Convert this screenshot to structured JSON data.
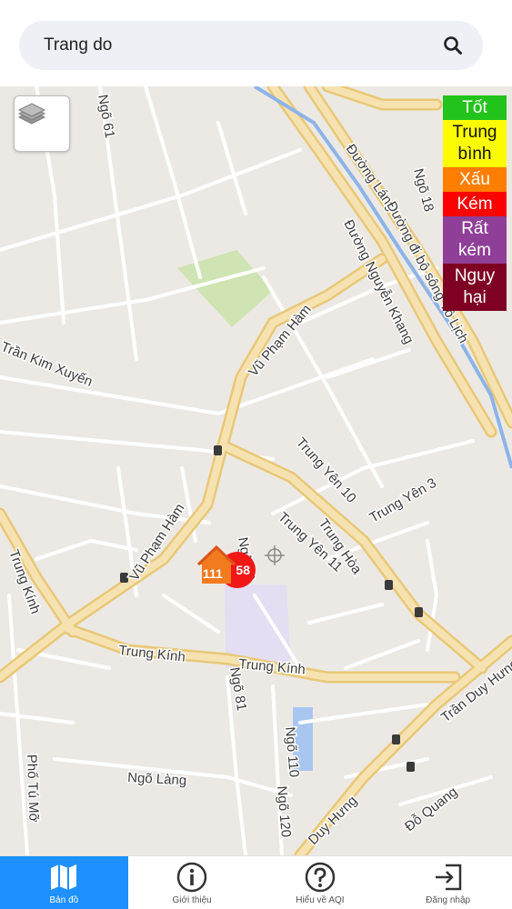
{
  "search": {
    "value": "Trang do",
    "icon": "search-icon"
  },
  "map": {
    "layer_button_icon": "layers-icon",
    "street_labels": [
      "Ngõ 61",
      "Đường Láng",
      "Ngõ 18",
      "Đường Nguyễn Khang",
      "Đường đi bộ sông Tô Lịch",
      "Vũ Phạm Hàm",
      "Trần Kim Xuyến",
      "Trung Yên 10",
      "Trung Yên 3",
      "Vũ Phạm Hàm",
      "Trung Yên 11",
      "Trung Hòa",
      "Trung Kính",
      "Trung Kính",
      "Trung Kính",
      "Ngõ 81",
      "Ngõ 89",
      "Ngõ 110",
      "Ngõ 120",
      "Ngõ Làng",
      "Phố Tú Mỡ",
      "Trần Duy Hưng",
      "Đỗ Quang",
      "Duy Hưng"
    ],
    "markers": {
      "house_value": "111",
      "circle_value": "58"
    }
  },
  "legend": [
    {
      "label": "Tốt",
      "color": "#22c31b",
      "text_color": "#ffffff"
    },
    {
      "label": "Trung bình",
      "color": "#fcfc00",
      "text_color": "#111111"
    },
    {
      "label": "Xấu",
      "color": "#ff7e00",
      "text_color": "#ffffff"
    },
    {
      "label": "Kém",
      "color": "#ff0000",
      "text_color": "#ffffff"
    },
    {
      "label": "Rất kém",
      "color": "#8f3f97",
      "text_color": "#ffffff"
    },
    {
      "label": "Nguy hại",
      "color": "#7e0023",
      "text_color": "#ffffff"
    }
  ],
  "nav": [
    {
      "label": "Bản đồ",
      "icon": "map-icon",
      "active": true
    },
    {
      "label": "Giới thiệu",
      "icon": "info-icon",
      "active": false
    },
    {
      "label": "Hiểu về AQI",
      "icon": "help-icon",
      "active": false
    },
    {
      "label": "Đăng nhập",
      "icon": "login-icon",
      "active": false
    }
  ],
  "colors": {
    "accent": "#1e90ff",
    "map_background": "#ece9e4",
    "major_road": "#f3d38a",
    "river": "#8db4e8",
    "park": "#cfe4b2",
    "marker_red": "#f21717",
    "marker_orange": "#f47a1f"
  }
}
